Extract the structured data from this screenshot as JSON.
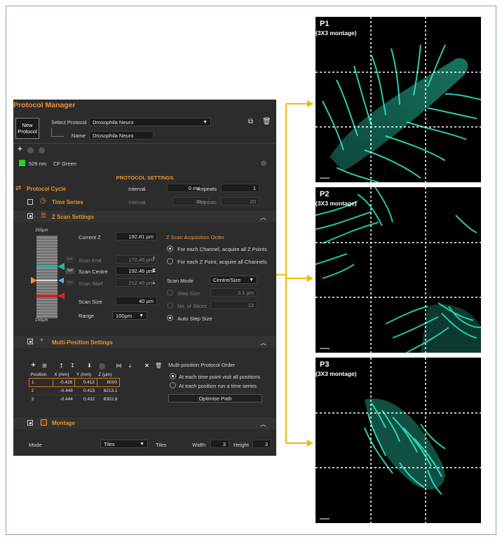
{
  "panel": {
    "title": "Protocol Manager",
    "new_protocol": "New Protocol",
    "select_protocol_label": "Select Protocol",
    "select_protocol_value": "Drosophila Neuro",
    "name_label": "Name",
    "name_value": "Drosophila Neuro",
    "laser_wavelength": "529 nm",
    "dye": "CF Green",
    "laser_color": "#27d12a"
  },
  "protocol_settings": {
    "heading": "PROTOCOL SETTINGS",
    "cycle_label": "Protocol Cycle",
    "interval_label": "Interval",
    "interval_value": "0 ms",
    "repeats_label": "Repeats",
    "repeats_value": "1"
  },
  "time_series": {
    "label": "Time Series",
    "interval_label": "Interval",
    "interval_value": "30 s",
    "repeats_label": "Repeats",
    "repeats_value": "20"
  },
  "z_scan": {
    "title": "Z Scan Settings",
    "top_label": "250µm",
    "bottom_label": "150µm",
    "current_z_label": "Current Z",
    "current_z_value": "192.81 µm",
    "set_label": "Set",
    "scan_end_label": "Scan End",
    "scan_end_value": "172.46 µm",
    "scan_centre_label": "Scan Centre",
    "scan_centre_value": "192.46 µm",
    "scan_start_label": "Scan Start",
    "scan_start_value": "212.46 µm",
    "scan_size_label": "Scan Size",
    "scan_size_value": "40 µm",
    "range_label": "Range",
    "range_value": "100µm",
    "order_title": "Z Scan Acquisition Order",
    "order_opt1": "For each Channel, acquire all Z Points",
    "order_opt2": "For each Z Point, acquire all Channels",
    "mode_label": "Scan Mode",
    "mode_value": "Centre/Size",
    "step_size_label": "Step Size",
    "step_size_value": "3.1 µm",
    "slices_label": "No. of Slices",
    "slices_value": "13",
    "auto_step_label": "Auto Step Size"
  },
  "multi_position": {
    "title": "Multi-Position Settings",
    "columns": [
      "Position",
      "X (mm)",
      "Y (mm)",
      "Z (µm)"
    ],
    "rows": [
      [
        "1",
        "-0.426",
        "0.413",
        "8000"
      ],
      [
        "2",
        "-0.448",
        "0.415",
        "8213.1"
      ],
      [
        "3",
        "-0.444",
        "0.432",
        "8302.8"
      ]
    ],
    "order_title": "Multi-position Protocol Order",
    "order_opt1": "At each time point visit all positions",
    "order_opt2": "At each position run a time series",
    "optimise_button": "Optimise Path"
  },
  "montage": {
    "title": "Montage",
    "mode_label": "Mode",
    "mode_value": "Tiles",
    "tiles_label": "Tiles",
    "width_label": "Width",
    "width_value": "3",
    "height_label": "Height",
    "height_value": "3"
  },
  "images": [
    {
      "label": "P1",
      "sub": "(3X3 montage)"
    },
    {
      "label": "P2",
      "sub": "(3X3 montage)"
    },
    {
      "label": "P3",
      "sub": "(3X3 montage)"
    }
  ],
  "colors": {
    "accent": "#f0932b",
    "arrow": "#f2b800",
    "signal": "#2ee6c0"
  }
}
